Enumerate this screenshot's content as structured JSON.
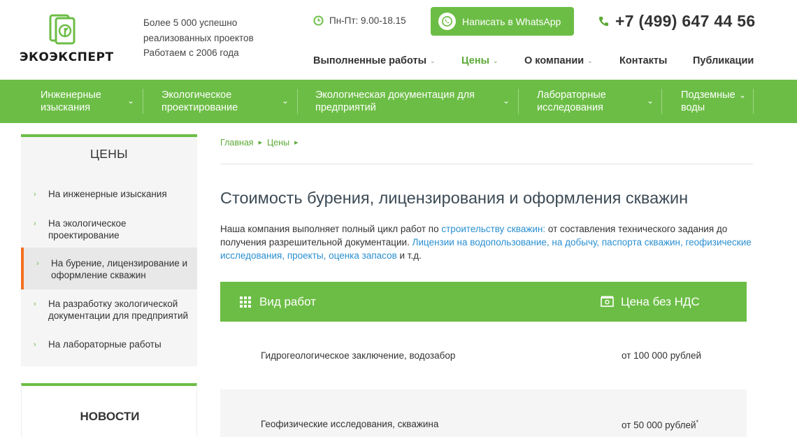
{
  "header": {
    "logo_text": "ЭКОЭКСПЕРТ",
    "tagline": [
      "Более 5 000 успешно",
      "реализованных проектов",
      "Работаем с 2006 года"
    ],
    "hours": "Пн-Пт: 9.00-18.15",
    "whatsapp_label": "Написать в WhatsApp",
    "phone": "+7 (499) 647 44 56",
    "nav": [
      {
        "label": "Выполненные работы",
        "has_dropdown": true
      },
      {
        "label": "Цены",
        "has_dropdown": true,
        "active": true
      },
      {
        "label": "О компании",
        "has_dropdown": true
      },
      {
        "label": "Контакты",
        "has_dropdown": false
      },
      {
        "label": "Публикации",
        "has_dropdown": false
      }
    ]
  },
  "main_menu": [
    {
      "line1": "Инженерные",
      "line2": "изыскания"
    },
    {
      "line1": "Экологическое",
      "line2": "проектирование"
    },
    {
      "line1": "Экологическая документация для",
      "line2": "предприятий"
    },
    {
      "line1": "Лабораторные",
      "line2": "исследования"
    },
    {
      "line1": "Подземные",
      "line2": "воды"
    }
  ],
  "sidebar": {
    "title": "ЦЕНЫ",
    "items": [
      {
        "label": "На инженерные изыскания"
      },
      {
        "label": "На экологическое проектирование"
      },
      {
        "label": "На бурение, лицензирование и оформление скважин",
        "active": true
      },
      {
        "label": "На разработку экологической документации для предприятий"
      },
      {
        "label": "На лабораторные работы"
      }
    ],
    "news_title": "НОВОСТИ"
  },
  "breadcrumb": [
    "Главная",
    "Цены"
  ],
  "page": {
    "title": "Стоимость бурения, лицензирования и оформления скважин",
    "intro_1": "Наша компания выполняет полный цикл работ по ",
    "intro_link_1": "строительству скважин:",
    "intro_2": " от составления технического задания до получения разрешительной документации. ",
    "intro_link_2": "Лицензии на водопользование, на добычу, паспорта скважин, геофизические исследования, проекты, оценка запасов",
    "intro_3": " и т.д."
  },
  "table": {
    "col_work": "Вид работ",
    "col_price": "Цена без НДС",
    "rows": [
      {
        "work": "Гидрогеологическое заключение, водозабор",
        "price": "от 100 000 рублей",
        "mark": ""
      },
      {
        "work": "Геофизические исследования, скважина",
        "price": "от 50 000 рублей",
        "mark": "*"
      }
    ]
  },
  "colors": {
    "accent": "#6cbd45",
    "active_marker": "#f37021",
    "link": "#2a8fd0"
  },
  "icons": [
    "logo-leaf-icon",
    "clock-icon",
    "whatsapp-icon",
    "phone-icon",
    "chevron-down-icon",
    "grid-icon",
    "price-tag-icon"
  ]
}
